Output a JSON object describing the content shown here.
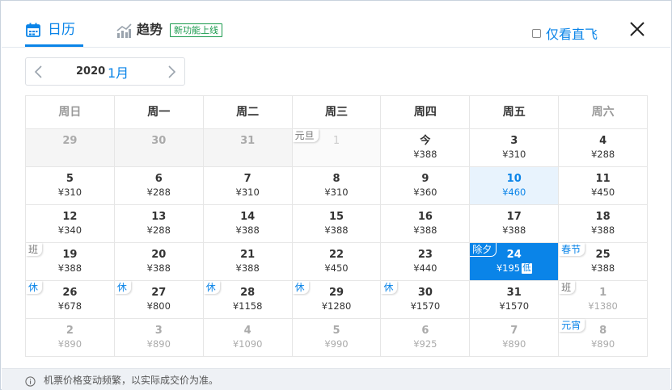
{
  "header": {
    "calendar_tab": "日历",
    "trend_tab": "趋势",
    "new_feature_badge": "新功能上线",
    "direct_only_label": "仅看直飞"
  },
  "month_selector": {
    "year": "2020",
    "month": "1月"
  },
  "weekdays": [
    "周日",
    "周一",
    "周二",
    "周三",
    "周四",
    "周五",
    "周六"
  ],
  "weeks": [
    [
      {
        "day": "29",
        "price": "",
        "state": "muted"
      },
      {
        "day": "30",
        "price": "",
        "state": "muted"
      },
      {
        "day": "31",
        "price": "",
        "state": "muted"
      },
      {
        "day": "1",
        "price": "",
        "state": "blank",
        "tag": "元旦"
      },
      {
        "day": "今",
        "price": "¥388"
      },
      {
        "day": "3",
        "price": "¥310"
      },
      {
        "day": "4",
        "price": "¥288"
      }
    ],
    [
      {
        "day": "5",
        "price": "¥310"
      },
      {
        "day": "6",
        "price": "¥288"
      },
      {
        "day": "7",
        "price": "¥310"
      },
      {
        "day": "8",
        "price": "¥310"
      },
      {
        "day": "9",
        "price": "¥360"
      },
      {
        "day": "10",
        "price": "¥460",
        "state": "hl"
      },
      {
        "day": "11",
        "price": "¥450"
      }
    ],
    [
      {
        "day": "12",
        "price": "¥340"
      },
      {
        "day": "13",
        "price": "¥288"
      },
      {
        "day": "14",
        "price": "¥388"
      },
      {
        "day": "15",
        "price": "¥388"
      },
      {
        "day": "16",
        "price": "¥388"
      },
      {
        "day": "17",
        "price": "¥388"
      },
      {
        "day": "18",
        "price": "¥388"
      }
    ],
    [
      {
        "day": "19",
        "price": "¥388",
        "tag": "班"
      },
      {
        "day": "20",
        "price": "¥388"
      },
      {
        "day": "21",
        "price": "¥388"
      },
      {
        "day": "22",
        "price": "¥450"
      },
      {
        "day": "23",
        "price": "¥440"
      },
      {
        "day": "24",
        "price": "¥195",
        "state": "sel",
        "tag": "除夕",
        "badge": "低"
      },
      {
        "day": "25",
        "price": "¥388",
        "tag": "春节"
      }
    ],
    [
      {
        "day": "26",
        "price": "¥678",
        "tag": "休"
      },
      {
        "day": "27",
        "price": "¥800",
        "tag": "休"
      },
      {
        "day": "28",
        "price": "¥1158",
        "tag": "休"
      },
      {
        "day": "29",
        "price": "¥1280",
        "tag": "休"
      },
      {
        "day": "30",
        "price": "¥1570",
        "tag": "休"
      },
      {
        "day": "31",
        "price": "¥1570"
      },
      {
        "day": "1",
        "price": "¥1380",
        "state": "gray",
        "tag": "班"
      }
    ],
    [
      {
        "day": "2",
        "price": "¥890",
        "state": "gray"
      },
      {
        "day": "3",
        "price": "¥890",
        "state": "gray"
      },
      {
        "day": "4",
        "price": "¥1090",
        "state": "gray"
      },
      {
        "day": "5",
        "price": "¥990",
        "state": "gray"
      },
      {
        "day": "6",
        "price": "¥925",
        "state": "gray"
      },
      {
        "day": "7",
        "price": "¥890",
        "state": "gray"
      },
      {
        "day": "8",
        "price": "¥890",
        "state": "gray",
        "tag": "元宵"
      }
    ]
  ],
  "footer_note": "机票价格变动频繁，以实际成交价为准。",
  "colors": {
    "accent": "#0a84e8",
    "badge_green": "#1a9a4d",
    "muted_bg": "#f5f5f5"
  },
  "icons": [
    "calendar-icon",
    "trend-chart-icon",
    "close-icon",
    "chevron-left-icon",
    "chevron-right-icon",
    "info-icon"
  ]
}
